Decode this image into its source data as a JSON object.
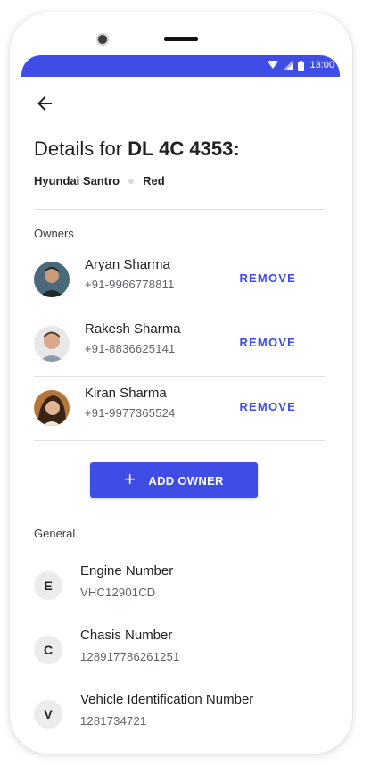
{
  "status_bar": {
    "time": "13:00",
    "icons": [
      "wifi-icon",
      "signal-icon",
      "battery-icon"
    ]
  },
  "header": {
    "title_prefix": "Details for ",
    "plate": "DL 4C 4353:",
    "car_model": "Hyundai Santro",
    "car_color": "Red"
  },
  "owners": {
    "label": "Owners",
    "items": [
      {
        "name": "Aryan Sharma",
        "phone": "+91-9966778811",
        "action": "REMOVE"
      },
      {
        "name": "Rakesh Sharma",
        "phone": "+91-8836625141",
        "action": "REMOVE"
      },
      {
        "name": "Kiran Sharma",
        "phone": "+91-9977365524",
        "action": "REMOVE"
      }
    ],
    "add_label": "ADD OWNER"
  },
  "general": {
    "label": "General",
    "items": [
      {
        "letter": "E",
        "title": "Engine Number",
        "value": "VHC12901CD"
      },
      {
        "letter": "C",
        "title": "Chasis Number",
        "value": "128917786261251"
      },
      {
        "letter": "V",
        "title": "Vehicle Identification Number",
        "value": "1281734721"
      }
    ]
  },
  "colors": {
    "accent": "#3f4ce6",
    "divider": "#e0e0e0",
    "letter_bg": "#ececec"
  }
}
